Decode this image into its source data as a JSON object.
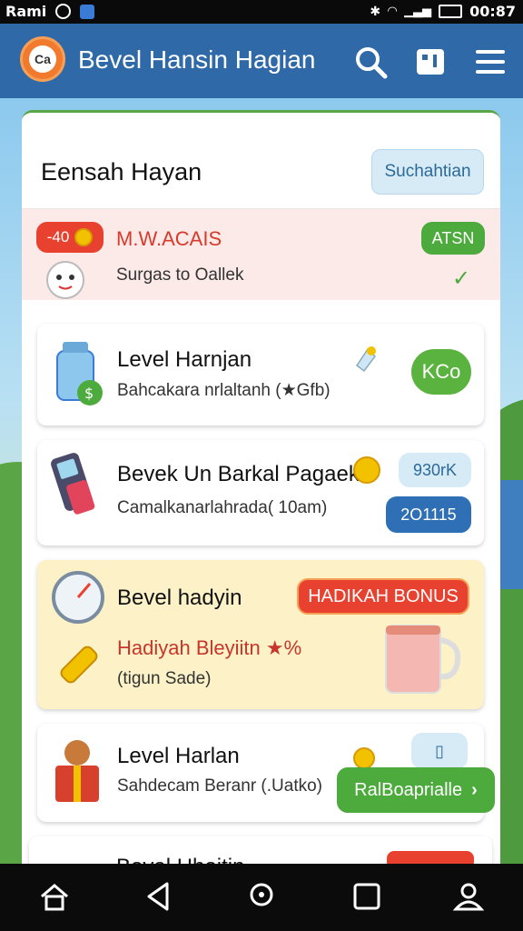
{
  "status_bar": {
    "carrier": "Rami",
    "time": "00:87"
  },
  "app_bar": {
    "title": "Bevel Hansin Hagian",
    "logo_text": "Ca",
    "icons": [
      "search-icon",
      "card-icon",
      "menu-icon"
    ]
  },
  "panel": {
    "title": "Eensah Hayan",
    "header_button": "Suchahtian"
  },
  "cards": [
    {
      "badge": "-40",
      "title": "M.W.ACAIS",
      "subtitle": "Surgas to Oallek",
      "action": "ATSN"
    },
    {
      "title": "Level Harnjan",
      "subtitle": "Bahcakara nrlaltanh (★Gfb)",
      "action": "KCo"
    },
    {
      "title": "Bevek Un Barkal Pagaek",
      "subtitle": "Camalkanarlahrada( 10am)",
      "tag": "930rK",
      "action": "2O1115"
    },
    {
      "title": "Bevel hadyin",
      "highlight": "Hadiyah Bleyiitn ★%",
      "subtitle": "(tigun Sade)",
      "banner": "HADIKAH BONUS"
    },
    {
      "title": "Level Harlan",
      "subtitle": "Sahdecam Beranr (.Uatko)",
      "action": "RalBoaprialle"
    },
    {
      "title": "Boval Hhoitin"
    }
  ],
  "colors": {
    "app_bar": "#2f69a8",
    "green": "#4cab3c",
    "red": "#e8412f",
    "blue": "#2f6fb5",
    "accent_orange": "#f17a2e"
  }
}
